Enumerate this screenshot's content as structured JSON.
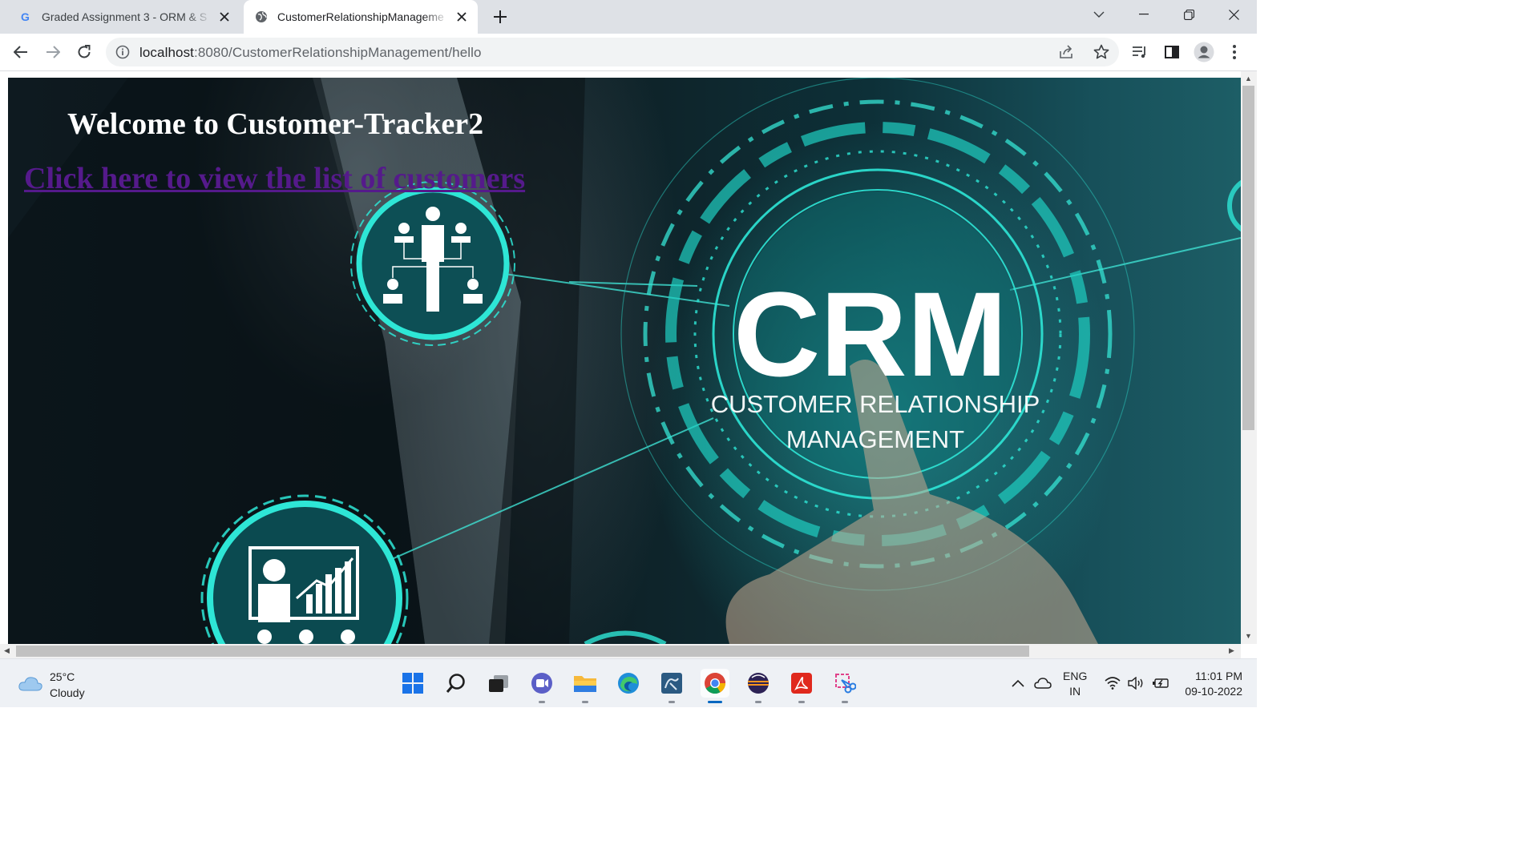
{
  "browser": {
    "tabs": [
      {
        "title": "Graded Assignment 3 - ORM & S",
        "active": false,
        "favicon": "google-g-icon"
      },
      {
        "title": "CustomerRelationshipManageme",
        "active": true,
        "favicon": "globe-icon"
      }
    ],
    "url_host": "localhost",
    "url_rest": ":8080/CustomerRelationshipManagement/hello"
  },
  "page": {
    "heading": "Welcome to Customer-Tracker2",
    "link_text": "Click here to view the list of customers",
    "hero_image": {
      "main_text": "CRM",
      "subtitle_line1": "CUSTOMER RELATIONSHIP",
      "subtitle_line2": "MANAGEMENT"
    }
  },
  "taskbar": {
    "weather": {
      "temp": "25°C",
      "condition": "Cloudy"
    },
    "apps": [
      "start-icon",
      "search-icon",
      "task-view-icon",
      "teams-chat-icon",
      "file-explorer-icon",
      "edge-icon",
      "mysql-workbench-icon",
      "chrome-icon",
      "eclipse-icon",
      "acrobat-icon",
      "snipping-tool-icon"
    ],
    "lang_line1": "ENG",
    "lang_line2": "IN",
    "time": "11:01 PM",
    "date": "09-10-2022"
  },
  "colors": {
    "link_visited": "#551a8b",
    "accent_cyan": "#2ee6d6",
    "tabstrip": "#dee1e6"
  }
}
